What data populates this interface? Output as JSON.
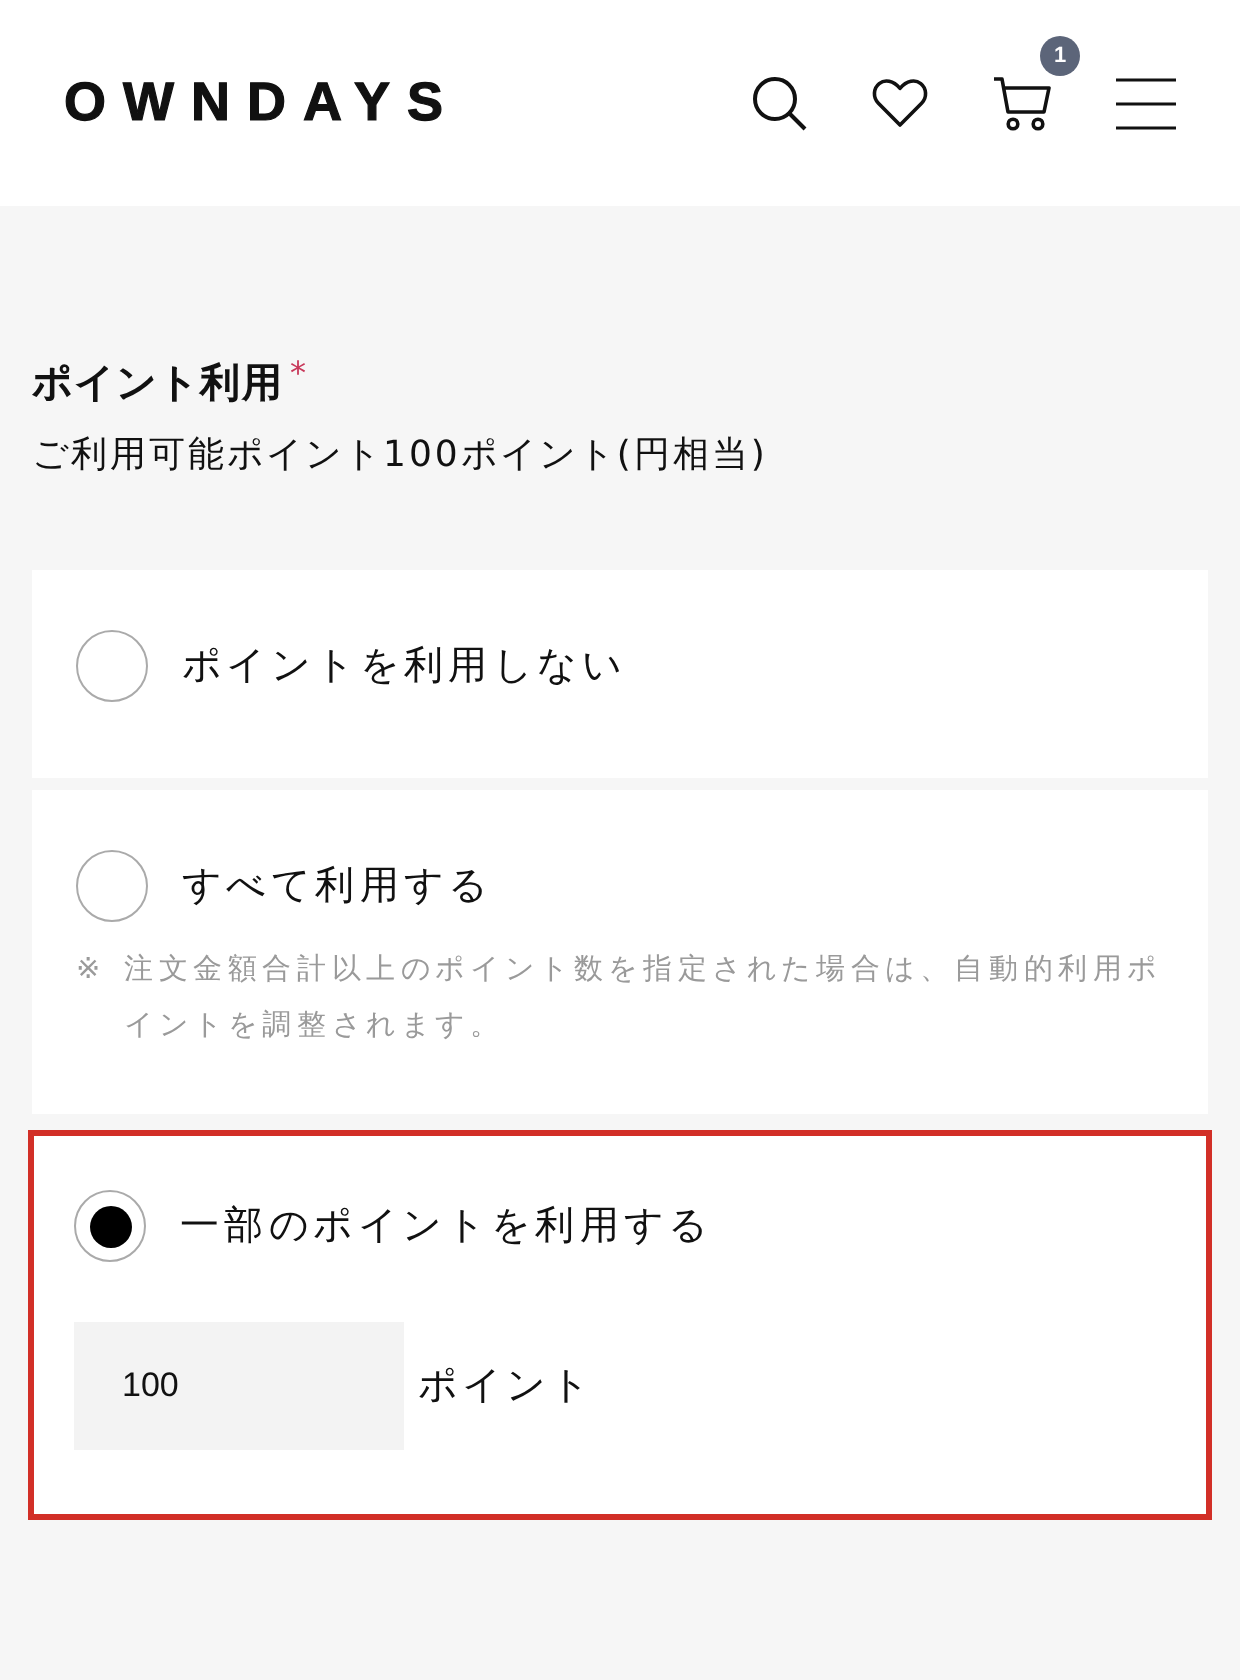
{
  "header": {
    "logo": "OWNDAYS",
    "cart_count": "1"
  },
  "section": {
    "title": "ポイント利用",
    "required_mark": "*",
    "available": "ご利用可能ポイント100ポイント(円相当)"
  },
  "options": [
    {
      "label": "ポイントを利用しない",
      "selected": false
    },
    {
      "label": "すべて利用する",
      "selected": false,
      "note_mark": "※",
      "note": "注文金額合計以上のポイント数を指定された場合は、自動的利用ポイントを調整されます。"
    },
    {
      "label": "一部のポイントを利用する",
      "selected": true,
      "input": {
        "value": "100",
        "unit": "ポイント"
      }
    }
  ]
}
